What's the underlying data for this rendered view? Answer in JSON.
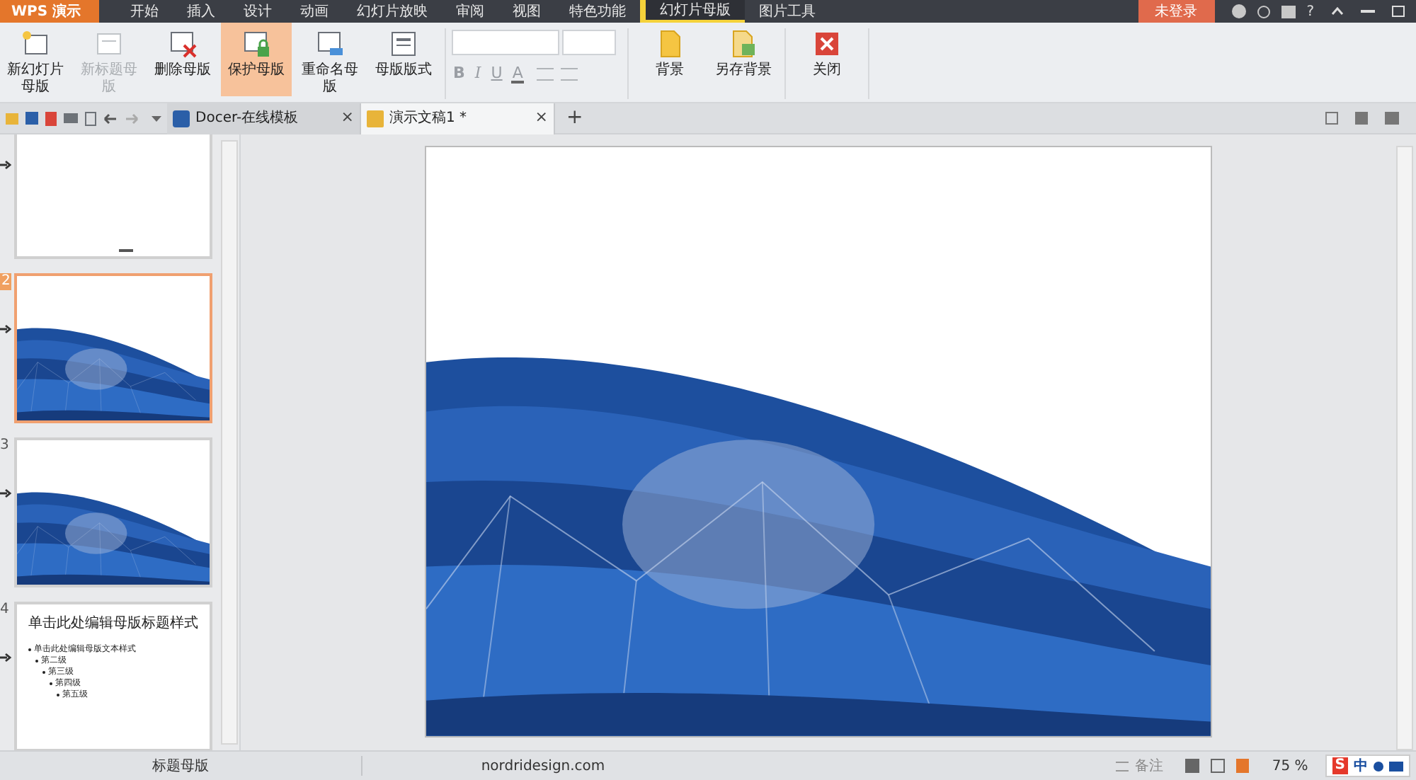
{
  "app_menu": "WPS 演示",
  "menu_tabs": [
    {
      "label": "开始",
      "selected": false
    },
    {
      "label": "插入",
      "selected": false
    },
    {
      "label": "设计",
      "selected": false
    },
    {
      "label": "动画",
      "selected": false
    },
    {
      "label": "幻灯片放映",
      "selected": false
    },
    {
      "label": "审阅",
      "selected": false
    },
    {
      "label": "视图",
      "selected": false
    },
    {
      "label": "特色功能",
      "selected": false
    },
    {
      "label": "幻灯片母版",
      "selected": true
    },
    {
      "label": "图片工具",
      "selected": false
    }
  ],
  "login": "未登录",
  "help": "?",
  "ribbon_left": [
    {
      "label": "新幻灯片母版",
      "disabled": false,
      "selected": false
    },
    {
      "label": "新标题母版",
      "disabled": true,
      "selected": false
    },
    {
      "label": "删除母版",
      "disabled": false,
      "selected": false
    },
    {
      "label": "保护母版",
      "disabled": false,
      "selected": true
    },
    {
      "label": "重命名母版",
      "disabled": false,
      "selected": false
    },
    {
      "label": "母版版式",
      "disabled": false,
      "selected": false
    }
  ],
  "format_buttons": [
    "B",
    "I",
    "U",
    "A"
  ],
  "ribbon_right": [
    {
      "label": "背景",
      "disabled": false,
      "selected": false
    },
    {
      "label": "另存背景",
      "disabled": false,
      "selected": false
    },
    {
      "label": "关闭",
      "disabled": false,
      "selected": false
    }
  ],
  "doc_tabs": [
    {
      "label": "Docer-在线模板",
      "close": "×",
      "selected": false
    },
    {
      "label": "演示文稿1 *",
      "close": "×",
      "selected": true
    }
  ],
  "new_tab": "+",
  "slides": [
    {
      "kind": "outline-top",
      "selected": false
    },
    {
      "number": "2",
      "kind": "picture",
      "selected": true
    },
    {
      "number": "3",
      "kind": "picture",
      "selected": false
    },
    {
      "number": "4",
      "kind": "text",
      "selected": false,
      "title": "单击此处编辑母版标题样式",
      "lines": [
        {
          "text": "单击此处编辑母版文本样式",
          "children": [
            {
              "text": "第二级",
              "children": [
                {
                  "text": "第三级",
                  "children": [
                    {
                      "text": "第四级",
                      "children": [
                        {
                          "text": "第五级"
                        }
                      ]
                    }
                  ]
                }
              ]
            }
          ]
        }
      ]
    }
  ],
  "status_bar": {
    "layout": "标题母版",
    "template": "nordridesign.com",
    "notes": "备注",
    "zoom": "75 %"
  },
  "ime": {
    "logo": "S",
    "mode": "中"
  }
}
